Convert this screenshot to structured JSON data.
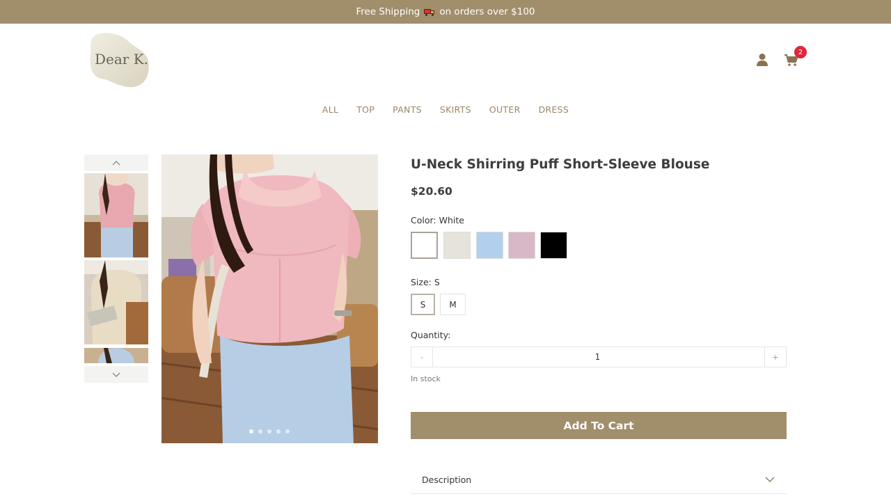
{
  "announcement": {
    "text_before": "Free Shipping",
    "text_after": "on orders over $100",
    "icon": "delivery-truck-icon"
  },
  "brand": {
    "logo_text": "Dear K."
  },
  "header": {
    "cart_count": "2",
    "icons": [
      "user-icon",
      "cart-icon"
    ]
  },
  "nav": {
    "items": [
      "ALL",
      "TOP",
      "PANTS",
      "SKIRTS",
      "OUTER",
      "DRESS"
    ]
  },
  "gallery": {
    "thumbnail_count": 3,
    "slide_count": 5,
    "active_slide": 1
  },
  "product": {
    "title": "U-Neck Shirring Puff Short-Sleeve Blouse",
    "price": "$20.60",
    "color_label": "Color:",
    "color_value": "White",
    "colors": [
      {
        "name": "White",
        "hex": "#ffffff"
      },
      {
        "name": "Beige",
        "hex": "#e6e3da"
      },
      {
        "name": "Sky Blue",
        "hex": "#b0d0ee"
      },
      {
        "name": "Pink",
        "hex": "#d8b8c6"
      },
      {
        "name": "Black",
        "hex": "#000000"
      }
    ],
    "size_label": "Size:",
    "size_value": "S",
    "sizes": [
      "S",
      "M"
    ],
    "quantity_label": "Quantity:",
    "quantity_minus": "-",
    "quantity_value": "1",
    "quantity_plus": "+",
    "stock_status": "In stock",
    "add_to_cart": "Add To Cart",
    "description_label": "Description"
  },
  "colors": {
    "accent": "#a18e6b",
    "nav_text": "#9a8566",
    "badge": "#e0263d"
  }
}
